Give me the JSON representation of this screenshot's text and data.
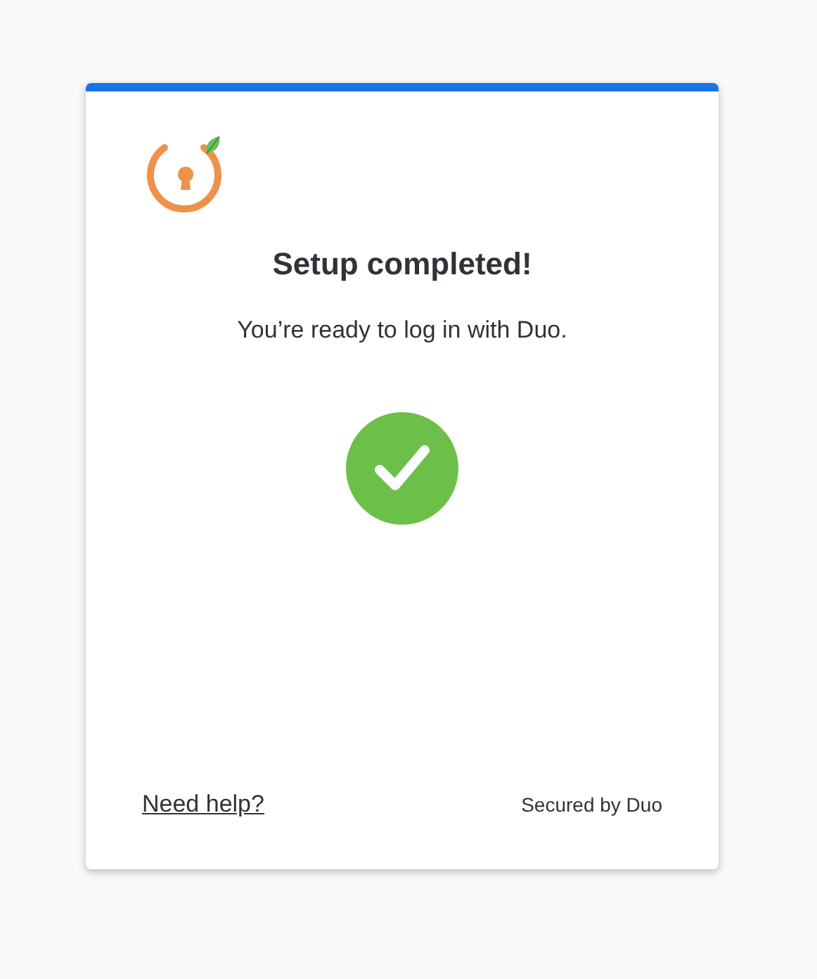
{
  "title": "Setup completed!",
  "message": "You’re ready to log in with Duo.",
  "status": {
    "kind": "success"
  },
  "footer": {
    "help_link": "Need help?",
    "secured_by": "Secured by Duo"
  }
}
